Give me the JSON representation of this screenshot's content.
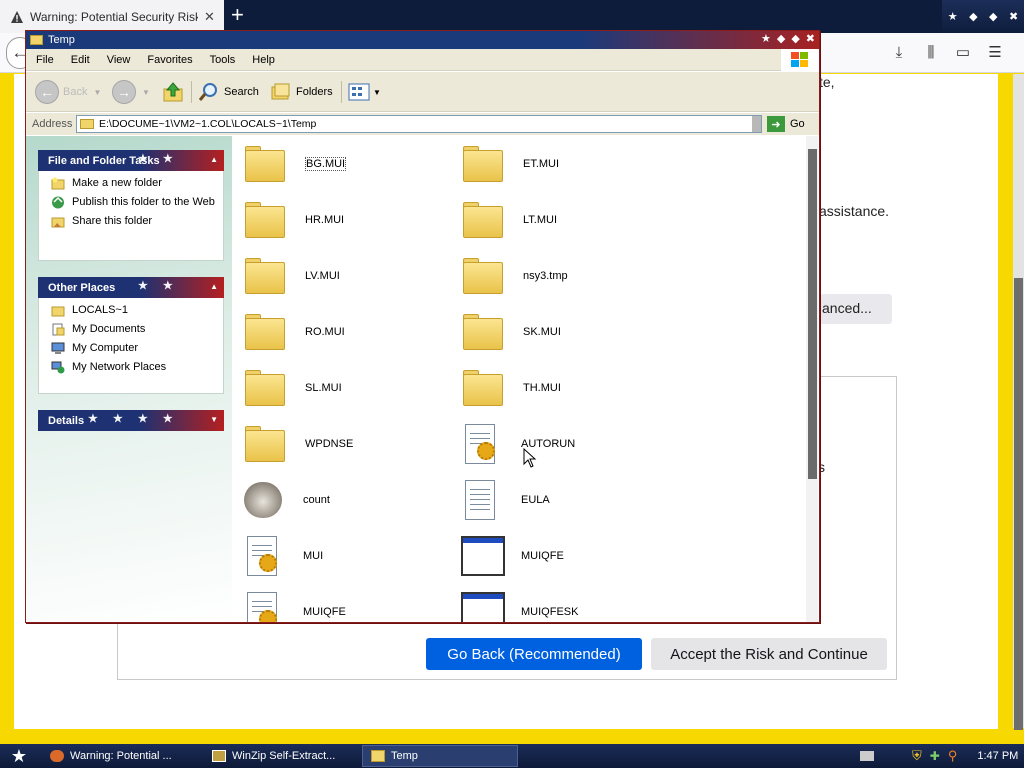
{
  "browser": {
    "tab_title": "Warning: Potential Security Risk A",
    "tab_close": "✕",
    "new_tab": "+",
    "back_icon": "←"
  },
  "ff_page": {
    "fragment_1": "te,",
    "fragment_2": "assistance.",
    "fragment_3": "anced...",
    "fragment_4": "s",
    "go_back_label": "Go Back (Recommended)",
    "accept_label": "Accept the Risk and Continue",
    "primary_color": "#0061e0"
  },
  "explorer": {
    "title": "Temp",
    "menu": [
      "File",
      "Edit",
      "View",
      "Favorites",
      "Tools",
      "Help"
    ],
    "toolbar": {
      "back_label": "Back",
      "search_label": "Search",
      "folders_label": "Folders"
    },
    "address": {
      "label": "Address",
      "value": "E:\\DOCUME~1\\VM2~1.COL\\LOCALS~1\\Temp",
      "go_label": "Go"
    },
    "panels": {
      "tasks": {
        "title": "File and Folder Tasks",
        "items": [
          "Make a new folder",
          "Publish this folder to the Web",
          "Share this folder"
        ]
      },
      "places": {
        "title": "Other Places",
        "items": [
          "LOCALS~1",
          "My Documents",
          "My Computer",
          "My Network Places"
        ]
      },
      "details": {
        "title": "Details"
      }
    },
    "files": [
      {
        "name": "BG.MUI",
        "kind": "folder"
      },
      {
        "name": "ET.MUI",
        "kind": "folder"
      },
      {
        "name": "HR.MUI",
        "kind": "folder"
      },
      {
        "name": "LT.MUI",
        "kind": "folder"
      },
      {
        "name": "LV.MUI",
        "kind": "folder"
      },
      {
        "name": "nsy3.tmp",
        "kind": "folder"
      },
      {
        "name": "RO.MUI",
        "kind": "folder"
      },
      {
        "name": "SK.MUI",
        "kind": "folder"
      },
      {
        "name": "SL.MUI",
        "kind": "folder"
      },
      {
        "name": "TH.MUI",
        "kind": "folder"
      },
      {
        "name": "WPDNSE",
        "kind": "folder"
      },
      {
        "name": "AUTORUN",
        "kind": "settings"
      },
      {
        "name": "count",
        "kind": "raccoon"
      },
      {
        "name": "EULA",
        "kind": "text"
      },
      {
        "name": "MUI",
        "kind": "settings"
      },
      {
        "name": "MUIQFE",
        "kind": "app"
      },
      {
        "name": "MUIQFE",
        "kind": "settings"
      },
      {
        "name": "MUIQFESK",
        "kind": "app"
      }
    ]
  },
  "taskbar": {
    "items": [
      "Warning: Potential ...",
      "WinZip Self-Extract...",
      "Temp"
    ],
    "clock": "1:47 PM"
  }
}
